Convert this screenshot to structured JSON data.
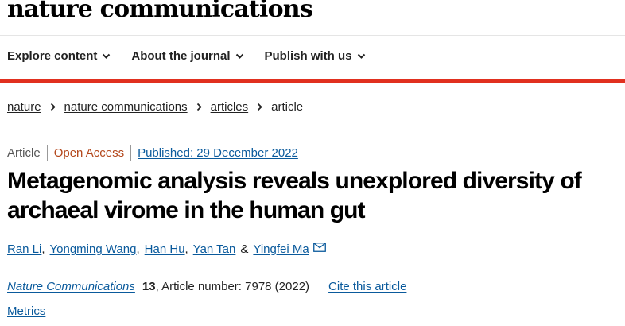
{
  "brand": "nature communications",
  "nav": {
    "items": [
      {
        "label": "Explore content"
      },
      {
        "label": "About the journal"
      },
      {
        "label": "Publish with us"
      }
    ]
  },
  "breadcrumb": {
    "items": [
      "nature",
      "nature communications",
      "articles"
    ],
    "current": "article"
  },
  "article_meta": {
    "type": "Article",
    "access": "Open Access",
    "published": "Published: 29 December 2022"
  },
  "title": "Metagenomic analysis reveals unexplored diversity of archaeal virome in the human gut",
  "authors": [
    "Ran Li",
    "Yongming Wang",
    "Han Hu",
    "Yan Tan",
    "Yingfei Ma"
  ],
  "author_separator": ",",
  "author_conjunction": "&",
  "citation": {
    "journal": "Nature Communications",
    "volume": "13",
    "article_number": ", Article number: 7978 (2022)",
    "cite_label": "Cite this article"
  },
  "metrics_label": "Metrics",
  "colors": {
    "accent_red": "#e1301f",
    "link_blue": "#0a5a9c",
    "open_access_orange": "#b3461a"
  },
  "icons": {
    "nav_chevron": "chevron-down-icon",
    "breadcrumb_separator": "chevron-right-icon",
    "corresponding_author": "mail-icon"
  }
}
